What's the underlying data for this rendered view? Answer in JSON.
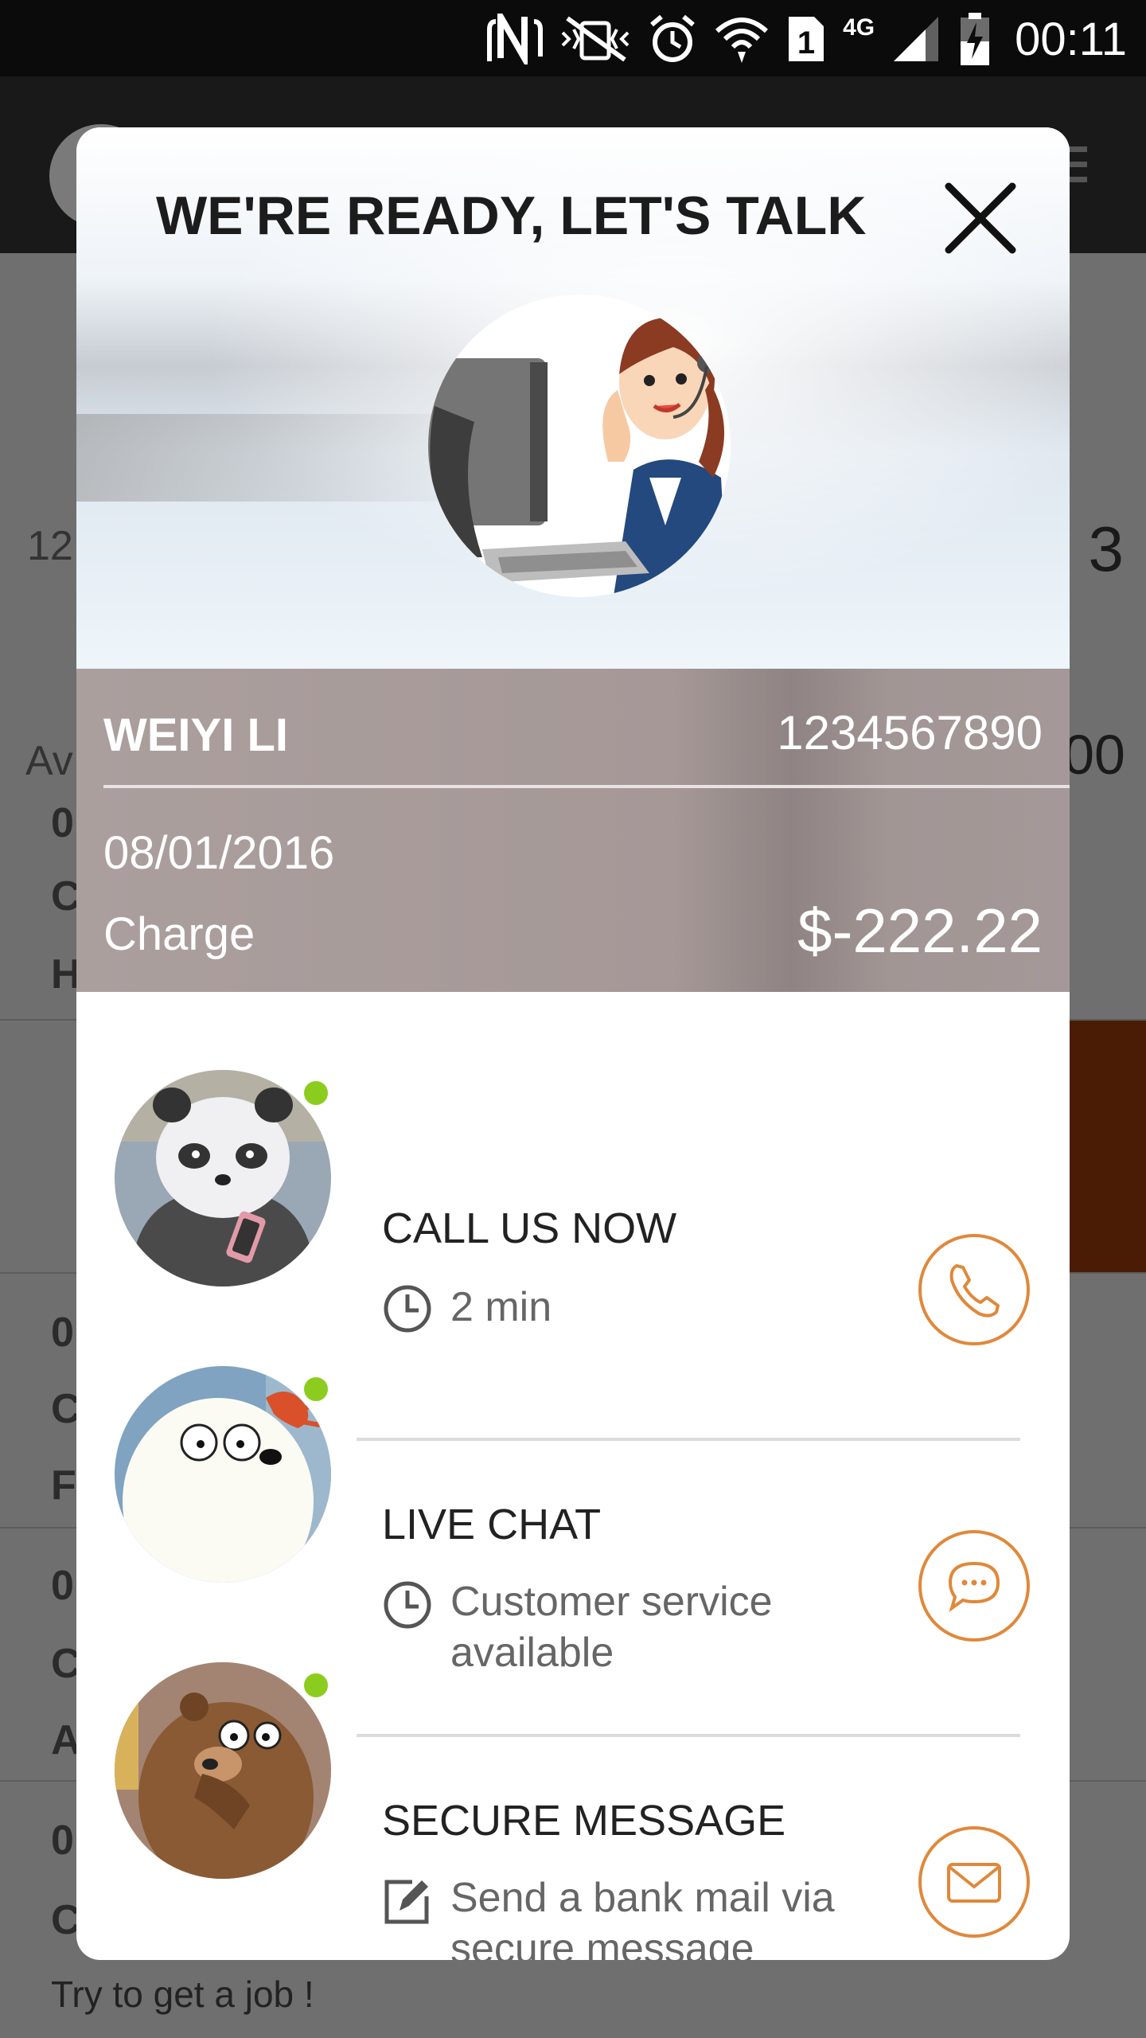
{
  "status_bar": {
    "network_type": "4G",
    "sim_slot": "1",
    "time": "00:11"
  },
  "background": {
    "large_number": "3",
    "small_number": "12",
    "available_label": "Av",
    "amount_fragment": "00",
    "row_letters": [
      "0",
      "C",
      "H",
      "0",
      "C",
      "F",
      "0",
      "C",
      "A",
      "0",
      "C"
    ],
    "footer_text": "Try to get a job !"
  },
  "dialog": {
    "title": "WE'RE READY, LET'S TALK",
    "account": {
      "name": "WEIYI LI",
      "number": "1234567890",
      "date": "08/01/2016",
      "type": "Charge",
      "amount": "$-222.22"
    },
    "options": [
      {
        "title": "CALL US NOW",
        "subtitle": "2 min",
        "subtitle_icon": "clock-icon",
        "action_icon": "phone-icon",
        "avatar": "panda-avatar",
        "online": true
      },
      {
        "title": "LIVE CHAT",
        "subtitle": "Customer service available",
        "subtitle_icon": "clock-icon",
        "action_icon": "chat-icon",
        "avatar": "polar-bear-avatar",
        "online": true
      },
      {
        "title": "SECURE MESSAGE",
        "subtitle": "Send a bank mail via secure message",
        "subtitle_icon": "compose-icon",
        "action_icon": "mail-icon",
        "avatar": "brown-bear-avatar",
        "online": true
      }
    ]
  },
  "colors": {
    "accent": "#e0883a",
    "online_dot": "#8ccc1f",
    "account_bg": "#a59897"
  }
}
